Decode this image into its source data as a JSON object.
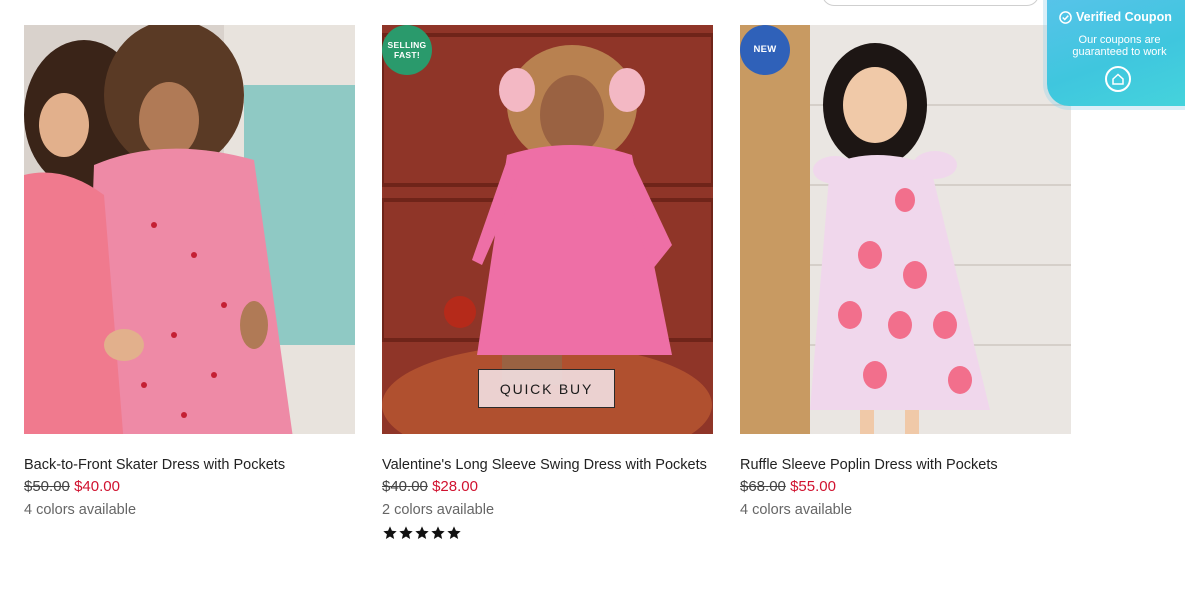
{
  "products": [
    {
      "badge": "",
      "title": "Back-to-Front Skater Dress with Pockets",
      "old_price": "$50.00",
      "price": "$40.00",
      "colors": "4 colors available"
    },
    {
      "badge": "SELLING FAST!",
      "badge_line1": "SELLING",
      "badge_line2": "FAST!",
      "title": "Valentine's Long Sleeve Swing Dress with Pockets",
      "old_price": "$40.00",
      "price": "$28.00",
      "colors": "2 colors available",
      "quick_buy": "QUICK BUY",
      "rating": 5
    },
    {
      "badge": "NEW",
      "title": "Ruffle Sleeve Poplin Dress with Pockets",
      "old_price": "$68.00",
      "price": "$55.00",
      "colors": "4 colors available"
    }
  ],
  "coupon": {
    "title": "Verified Coupon",
    "subtitle": "Our coupons are guaranteed to work",
    "icon": "shield-check-icon",
    "logo": "home-logo-icon"
  },
  "colors": {
    "sale_price": "#d0122f",
    "badge_selling": "#2a9a6c",
    "badge_new": "#2f61b9",
    "coupon_bg": "#48c7e2"
  }
}
